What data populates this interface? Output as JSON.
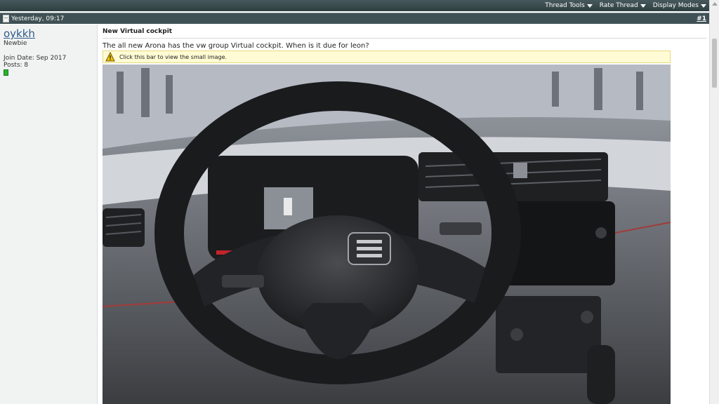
{
  "toolbar": {
    "items": [
      {
        "label": "Thread Tools"
      },
      {
        "label": "Rate Thread"
      },
      {
        "label": "Display Modes"
      }
    ]
  },
  "post": {
    "date": "Yesterday, 09:17",
    "number": "#1",
    "author": {
      "username": "oykkh",
      "title": "Newbie",
      "join_date": "Join Date: Sep 2017",
      "posts": "Posts: 8"
    },
    "title": "New Virtual cockpit",
    "message": "The all new Arona has the vw group Virtual cockpit. When is it due for leon?",
    "resize_notice": "Click this bar to view the small image."
  },
  "colors": {
    "header_bar": "#3f5154",
    "username_link": "#2f5a8a",
    "notice_bg": "#fffbd4",
    "online_indicator": "#27b42d"
  },
  "icons": {
    "post_icon": "document-icon",
    "notice_icon": "warning-icon",
    "dropdown_icon": "caret-down-icon"
  }
}
